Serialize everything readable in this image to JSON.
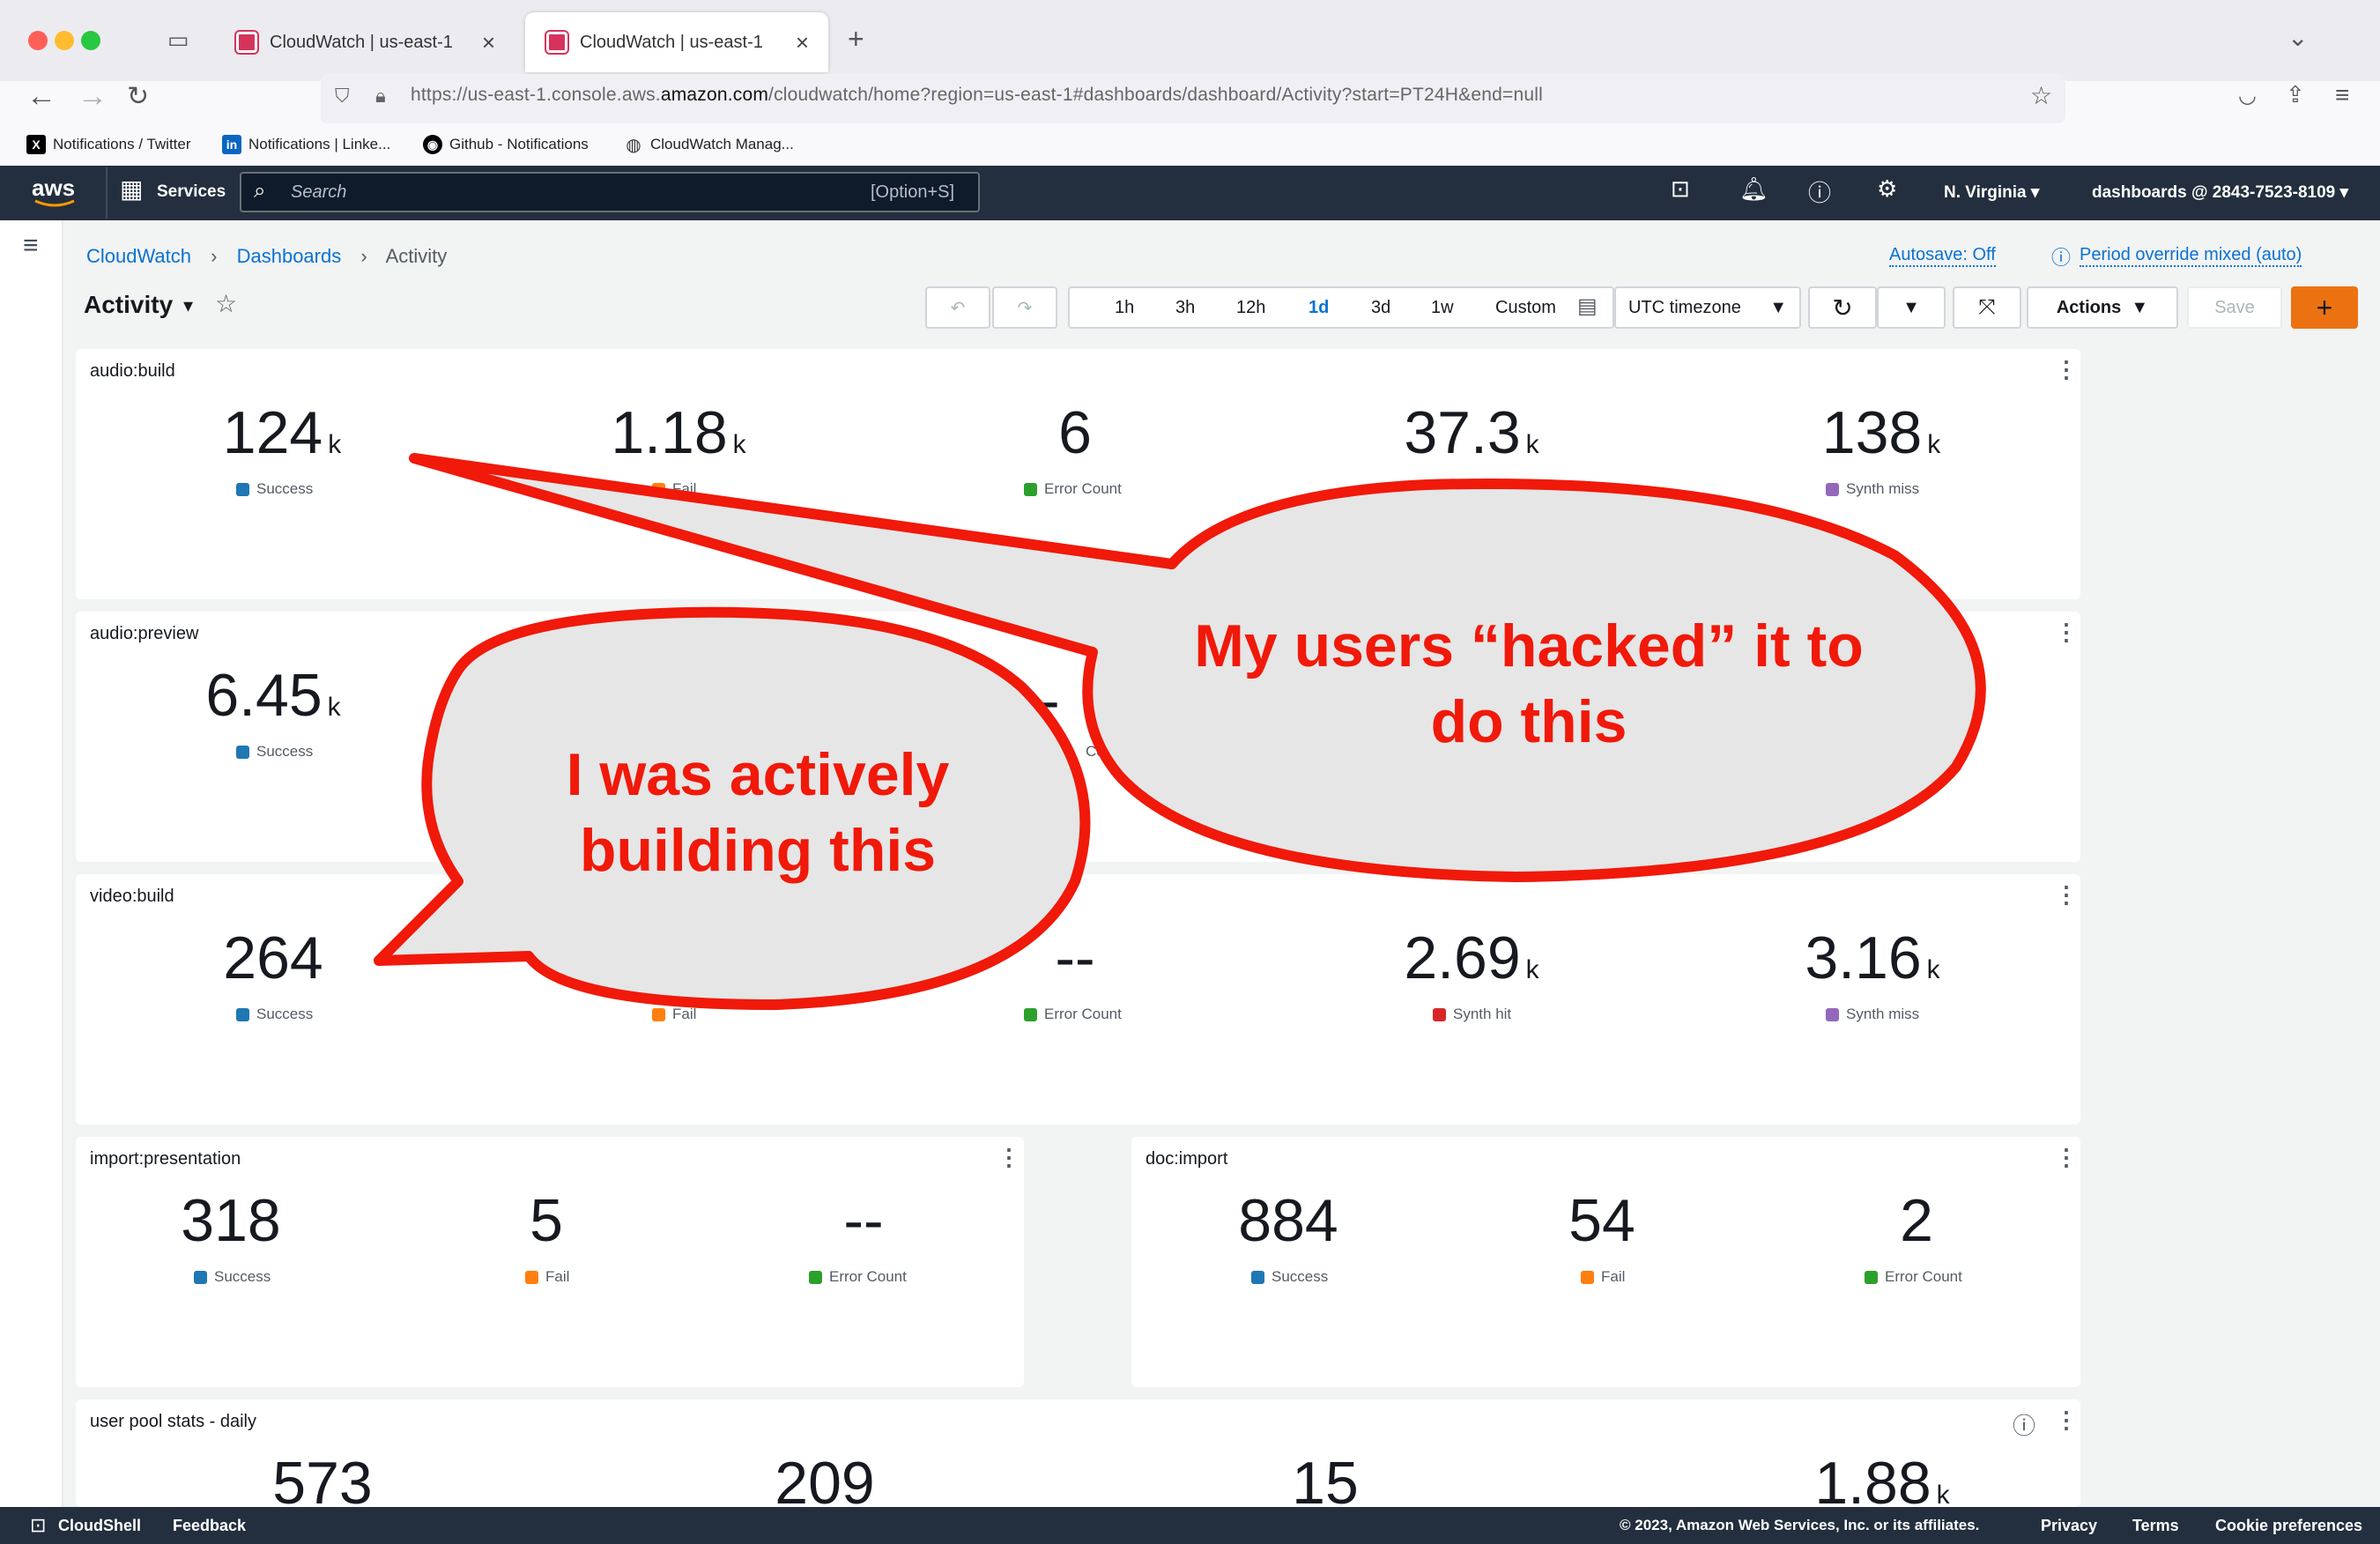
{
  "browser": {
    "tabs": [
      {
        "label": "CloudWatch | us-east-1"
      },
      {
        "label": "CloudWatch | us-east-1"
      }
    ],
    "url_prefix": "https://us-east-1.console.aws.",
    "url_host": "amazon.com",
    "url_rest": "/cloudwatch/home?region=us-east-1#dashboards/dashboard/Activity?start=PT24H&end=null",
    "bookmarks": [
      {
        "label": "Notifications / Twitter",
        "icon": "x-icon"
      },
      {
        "label": "Notifications | Linke...",
        "icon": "linkedin-icon"
      },
      {
        "label": "Github - Notifications",
        "icon": "github-icon"
      },
      {
        "label": "CloudWatch Manag...",
        "icon": "globe-icon"
      }
    ]
  },
  "aws_nav": {
    "logo": "aws",
    "services": "Services",
    "search_placeholder": "Search",
    "search_shortcut": "[Option+S]",
    "region": "N. Virginia",
    "account": "dashboards @ 2843-7523-8109"
  },
  "breadcrumb": [
    "CloudWatch",
    "Dashboards",
    "Activity"
  ],
  "autosave": "Autosave: Off",
  "period_override": "Period override mixed (auto)",
  "dashboard_title": "Activity",
  "toolbar": {
    "ranges": [
      "1h",
      "3h",
      "12h",
      "1d",
      "3d",
      "1w",
      "Custom"
    ],
    "selected_range": "1d",
    "timezone": "UTC timezone",
    "actions": "Actions",
    "save": "Save",
    "add": "+"
  },
  "colors": {
    "success": "#1f77b4",
    "fail": "#ff7f0e",
    "error": "#2ca02c",
    "synth_hit": "#d62728",
    "synth_miss": "#9467bd",
    "accent": "#ec7211",
    "bubble_outline": "#f0190a",
    "bubble_fill": "#e6e6e6"
  },
  "widgets": [
    {
      "title": "audio:build",
      "metrics": [
        {
          "value": "124",
          "unit": "k",
          "label": "Success"
        },
        {
          "value": "1.18",
          "unit": "k",
          "label": "Fail"
        },
        {
          "value": "6",
          "unit": "",
          "label": "Error Count"
        },
        {
          "value": "37.3",
          "unit": "k",
          "label": ""
        },
        {
          "value": "138",
          "unit": "k",
          "label": "Synth miss"
        }
      ]
    },
    {
      "title": "audio:preview",
      "metrics": [
        {
          "value": "6.45",
          "unit": "k",
          "label": "Success"
        },
        {
          "value": "-",
          "unit": "",
          "label": "Co"
        }
      ]
    },
    {
      "title": "video:build",
      "metrics": [
        {
          "value": "264",
          "unit": "",
          "label": "Success"
        },
        {
          "value": "",
          "unit": "",
          "label": "Fail"
        },
        {
          "value": "--",
          "unit": "",
          "label": "Error Count"
        },
        {
          "value": "2.69",
          "unit": "k",
          "label": "Synth hit"
        },
        {
          "value": "3.16",
          "unit": "k",
          "label": "Synth miss"
        }
      ]
    },
    {
      "title": "import:presentation",
      "metrics": [
        {
          "value": "318",
          "unit": "",
          "label": "Success"
        },
        {
          "value": "5",
          "unit": "",
          "label": "Fail"
        },
        {
          "value": "--",
          "unit": "",
          "label": "Error Count"
        }
      ]
    },
    {
      "title": "doc:import",
      "metrics": [
        {
          "value": "884",
          "unit": "",
          "label": "Success"
        },
        {
          "value": "54",
          "unit": "",
          "label": "Fail"
        },
        {
          "value": "2",
          "unit": "",
          "label": "Error Count"
        }
      ]
    },
    {
      "title": "user pool stats - daily",
      "metrics": [
        {
          "value": "573",
          "unit": ""
        },
        {
          "value": "209",
          "unit": ""
        },
        {
          "value": "15",
          "unit": ""
        },
        {
          "value": "1.88",
          "unit": "k"
        }
      ]
    }
  ],
  "annotations": {
    "bubble_right": [
      "My users “hacked” it to",
      "do this"
    ],
    "bubble_left": [
      "I was actively",
      "building this"
    ]
  },
  "footer": {
    "cloudshell": "CloudShell",
    "feedback": "Feedback",
    "copyright": "© 2023, Amazon Web Services, Inc. or its affiliates.",
    "privacy": "Privacy",
    "terms": "Terms",
    "cookies": "Cookie preferences"
  }
}
